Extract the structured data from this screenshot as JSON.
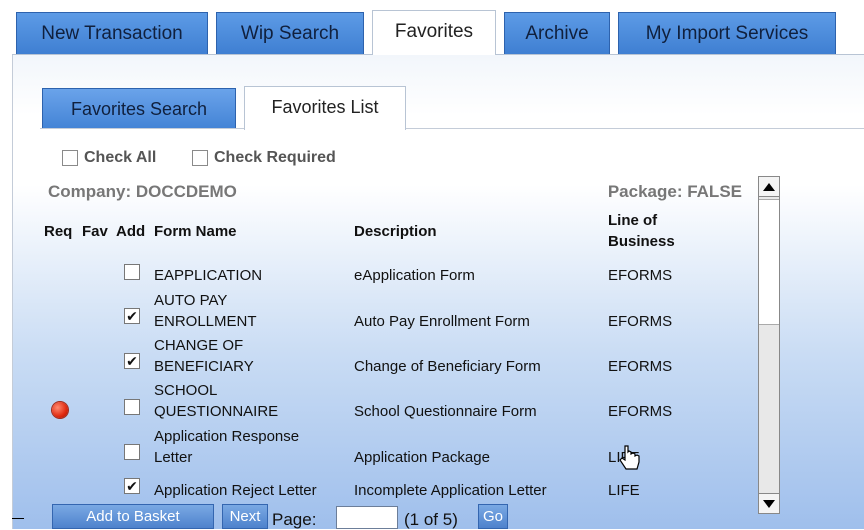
{
  "top_tabs": [
    {
      "label": "New Transaction",
      "active": false
    },
    {
      "label": "Wip Search",
      "active": false
    },
    {
      "label": "Favorites",
      "active": true
    },
    {
      "label": "Archive",
      "active": false
    },
    {
      "label": "My Import Services",
      "active": false
    }
  ],
  "sub_tabs": [
    {
      "label": "Favorites Search",
      "active": false
    },
    {
      "label": "Favorites List",
      "active": true
    }
  ],
  "filters": {
    "check_all": {
      "label": "Check All",
      "checked": false
    },
    "check_required": {
      "label": "Check Required",
      "checked": false
    }
  },
  "company": "Company: DOCCDEMO",
  "package": "Package: FALSE",
  "columns": {
    "req": "Req",
    "fav": "Fav",
    "add": "Add",
    "form_name": "Form Name",
    "description": "Description",
    "line_of_business_1": "Line of",
    "line_of_business_2": "Business"
  },
  "rows": [
    {
      "required": false,
      "checked": false,
      "name_1": "",
      "name_2": "EAPPLICATION",
      "description": "eApplication Form",
      "lob": "EFORMS"
    },
    {
      "required": false,
      "checked": true,
      "name_1": "AUTO PAY",
      "name_2": "ENROLLMENT",
      "description": "Auto Pay Enrollment Form",
      "lob": "EFORMS"
    },
    {
      "required": false,
      "checked": true,
      "name_1": "CHANGE OF",
      "name_2": "BENEFICIARY",
      "description": "Change of Beneficiary Form",
      "lob": "EFORMS"
    },
    {
      "required": true,
      "checked": false,
      "name_1": "SCHOOL",
      "name_2": "QUESTIONNAIRE",
      "description": "School Questionnaire Form",
      "lob": "EFORMS"
    },
    {
      "required": false,
      "checked": false,
      "name_1": "Application Response",
      "name_2": "Letter",
      "description": "Application Package",
      "lob": "LIFE"
    },
    {
      "required": false,
      "checked": true,
      "name_1": "",
      "name_2": "Application Reject Letter",
      "description": "Incomplete Application Letter",
      "lob": "LIFE"
    }
  ],
  "footer": {
    "add_to_basket": "Add to Basket",
    "next": "Next",
    "page_label": "Page:",
    "page_value": "",
    "page_of": "(1 of 5)",
    "go": "Go"
  },
  "check_mark": "✔",
  "colors": {
    "tab_blue": "#4a8ad9",
    "panel_gradient_end": "#9fbfec",
    "required_dot": "#e02a10"
  },
  "icons": {
    "scroll_up": "scroll-up-arrow-icon",
    "scroll_down": "scroll-down-arrow-icon",
    "required": "required-dot-icon",
    "cursor": "mouse-cursor-icon"
  }
}
